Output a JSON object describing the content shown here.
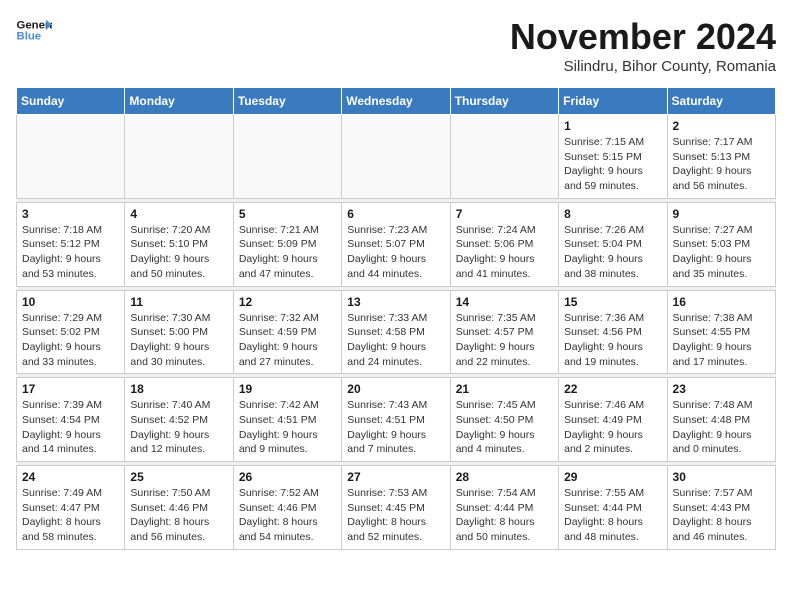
{
  "logo": {
    "line1": "General",
    "line2": "Blue"
  },
  "title": "November 2024",
  "subtitle": "Silindru, Bihor County, Romania",
  "weekdays": [
    "Sunday",
    "Monday",
    "Tuesday",
    "Wednesday",
    "Thursday",
    "Friday",
    "Saturday"
  ],
  "weeks": [
    [
      {
        "day": "",
        "info": ""
      },
      {
        "day": "",
        "info": ""
      },
      {
        "day": "",
        "info": ""
      },
      {
        "day": "",
        "info": ""
      },
      {
        "day": "",
        "info": ""
      },
      {
        "day": "1",
        "info": "Sunrise: 7:15 AM\nSunset: 5:15 PM\nDaylight: 9 hours and 59 minutes."
      },
      {
        "day": "2",
        "info": "Sunrise: 7:17 AM\nSunset: 5:13 PM\nDaylight: 9 hours and 56 minutes."
      }
    ],
    [
      {
        "day": "3",
        "info": "Sunrise: 7:18 AM\nSunset: 5:12 PM\nDaylight: 9 hours and 53 minutes."
      },
      {
        "day": "4",
        "info": "Sunrise: 7:20 AM\nSunset: 5:10 PM\nDaylight: 9 hours and 50 minutes."
      },
      {
        "day": "5",
        "info": "Sunrise: 7:21 AM\nSunset: 5:09 PM\nDaylight: 9 hours and 47 minutes."
      },
      {
        "day": "6",
        "info": "Sunrise: 7:23 AM\nSunset: 5:07 PM\nDaylight: 9 hours and 44 minutes."
      },
      {
        "day": "7",
        "info": "Sunrise: 7:24 AM\nSunset: 5:06 PM\nDaylight: 9 hours and 41 minutes."
      },
      {
        "day": "8",
        "info": "Sunrise: 7:26 AM\nSunset: 5:04 PM\nDaylight: 9 hours and 38 minutes."
      },
      {
        "day": "9",
        "info": "Sunrise: 7:27 AM\nSunset: 5:03 PM\nDaylight: 9 hours and 35 minutes."
      }
    ],
    [
      {
        "day": "10",
        "info": "Sunrise: 7:29 AM\nSunset: 5:02 PM\nDaylight: 9 hours and 33 minutes."
      },
      {
        "day": "11",
        "info": "Sunrise: 7:30 AM\nSunset: 5:00 PM\nDaylight: 9 hours and 30 minutes."
      },
      {
        "day": "12",
        "info": "Sunrise: 7:32 AM\nSunset: 4:59 PM\nDaylight: 9 hours and 27 minutes."
      },
      {
        "day": "13",
        "info": "Sunrise: 7:33 AM\nSunset: 4:58 PM\nDaylight: 9 hours and 24 minutes."
      },
      {
        "day": "14",
        "info": "Sunrise: 7:35 AM\nSunset: 4:57 PM\nDaylight: 9 hours and 22 minutes."
      },
      {
        "day": "15",
        "info": "Sunrise: 7:36 AM\nSunset: 4:56 PM\nDaylight: 9 hours and 19 minutes."
      },
      {
        "day": "16",
        "info": "Sunrise: 7:38 AM\nSunset: 4:55 PM\nDaylight: 9 hours and 17 minutes."
      }
    ],
    [
      {
        "day": "17",
        "info": "Sunrise: 7:39 AM\nSunset: 4:54 PM\nDaylight: 9 hours and 14 minutes."
      },
      {
        "day": "18",
        "info": "Sunrise: 7:40 AM\nSunset: 4:52 PM\nDaylight: 9 hours and 12 minutes."
      },
      {
        "day": "19",
        "info": "Sunrise: 7:42 AM\nSunset: 4:51 PM\nDaylight: 9 hours and 9 minutes."
      },
      {
        "day": "20",
        "info": "Sunrise: 7:43 AM\nSunset: 4:51 PM\nDaylight: 9 hours and 7 minutes."
      },
      {
        "day": "21",
        "info": "Sunrise: 7:45 AM\nSunset: 4:50 PM\nDaylight: 9 hours and 4 minutes."
      },
      {
        "day": "22",
        "info": "Sunrise: 7:46 AM\nSunset: 4:49 PM\nDaylight: 9 hours and 2 minutes."
      },
      {
        "day": "23",
        "info": "Sunrise: 7:48 AM\nSunset: 4:48 PM\nDaylight: 9 hours and 0 minutes."
      }
    ],
    [
      {
        "day": "24",
        "info": "Sunrise: 7:49 AM\nSunset: 4:47 PM\nDaylight: 8 hours and 58 minutes."
      },
      {
        "day": "25",
        "info": "Sunrise: 7:50 AM\nSunset: 4:46 PM\nDaylight: 8 hours and 56 minutes."
      },
      {
        "day": "26",
        "info": "Sunrise: 7:52 AM\nSunset: 4:46 PM\nDaylight: 8 hours and 54 minutes."
      },
      {
        "day": "27",
        "info": "Sunrise: 7:53 AM\nSunset: 4:45 PM\nDaylight: 8 hours and 52 minutes."
      },
      {
        "day": "28",
        "info": "Sunrise: 7:54 AM\nSunset: 4:44 PM\nDaylight: 8 hours and 50 minutes."
      },
      {
        "day": "29",
        "info": "Sunrise: 7:55 AM\nSunset: 4:44 PM\nDaylight: 8 hours and 48 minutes."
      },
      {
        "day": "30",
        "info": "Sunrise: 7:57 AM\nSunset: 4:43 PM\nDaylight: 8 hours and 46 minutes."
      }
    ]
  ]
}
